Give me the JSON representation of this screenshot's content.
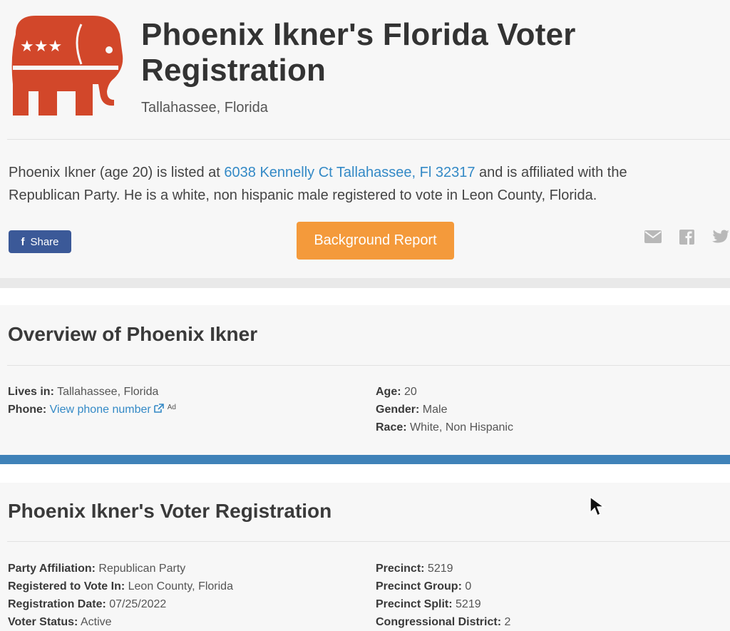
{
  "header": {
    "title": "Phoenix Ikner's Florida Voter Registration",
    "subtitle": "Tallahassee, Florida",
    "logo_color": "#d2472a"
  },
  "intro": {
    "text_before": "Phoenix Ikner (age 20) is listed at ",
    "address_link": "6038 Kennelly Ct Tallahassee, Fl 32317",
    "text_after_line1": " and is affiliated with the",
    "line2": "Republican Party. He is a white, non hispanic male registered to vote in Leon County, Florida."
  },
  "actions": {
    "share_label": "Share",
    "background_report_label": "Background Report"
  },
  "social_icons": [
    "mail-icon",
    "facebook-icon",
    "twitter-icon"
  ],
  "overview": {
    "title": "Overview of Phoenix Ikner",
    "left": [
      {
        "key": "Lives in:",
        "value": "Tallahassee, Florida"
      },
      {
        "key": "Phone:",
        "link": "View phone number",
        "ad": "Ad"
      }
    ],
    "right": [
      {
        "key": "Age:",
        "value": "20"
      },
      {
        "key": "Gender:",
        "value": "Male"
      },
      {
        "key": "Race:",
        "value": "White, Non Hispanic"
      }
    ]
  },
  "registration": {
    "title": "Phoenix Ikner's Voter Registration",
    "left": [
      {
        "key": "Party Affiliation:",
        "value": "Republican Party"
      },
      {
        "key": "Registered to Vote In:",
        "value": "Leon County, Florida"
      },
      {
        "key": "Registration Date:",
        "value": "07/25/2022"
      },
      {
        "key": "Voter Status:",
        "value": "Active"
      }
    ],
    "right": [
      {
        "key": "Precinct:",
        "value": "5219"
      },
      {
        "key": "Precinct Group:",
        "value": "0"
      },
      {
        "key": "Precinct Split:",
        "value": "5219"
      },
      {
        "key": "Congressional District:",
        "value": "2"
      }
    ]
  },
  "colors": {
    "accent_blue": "#3389c6",
    "divider_blue": "#3f82b8",
    "report_orange": "#f49a3b",
    "facebook_blue": "#3b5998"
  }
}
